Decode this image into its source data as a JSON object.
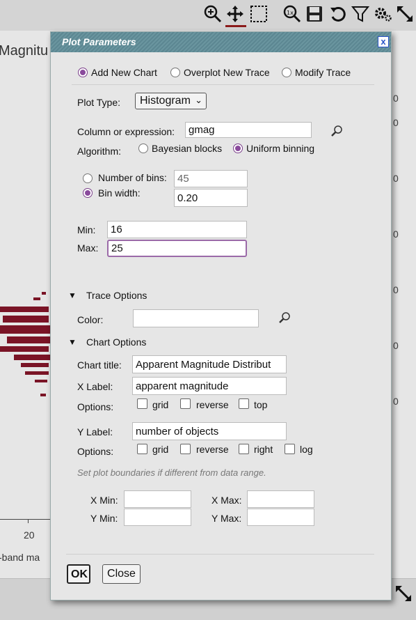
{
  "background": {
    "title": "Magnitu",
    "x_tick_label": "20",
    "x_axis_label": "-band ma",
    "y_axis_right_labels": [
      "0",
      "0",
      "0",
      "0",
      "0",
      "0",
      "0"
    ],
    "data_color": "#7a1426",
    "toolbar_icons": [
      "zoom-in-icon",
      "pan-icon",
      "select-icon",
      "zoom-reset-icon",
      "save-icon",
      "restore-icon",
      "filter-icon",
      "settings-icon",
      "expand-icon"
    ]
  },
  "dialog": {
    "title": "Plot Parameters",
    "close_label": "x",
    "modes": [
      {
        "label": "Add New Chart",
        "selected": true
      },
      {
        "label": "Overplot New Trace",
        "selected": false
      },
      {
        "label": "Modify Trace",
        "selected": false
      }
    ],
    "plot_type": {
      "label": "Plot Type:",
      "value": "Histogram"
    },
    "column": {
      "label": "Column or expression:",
      "value": "gmag"
    },
    "algorithm": {
      "label": "Algorithm:",
      "options": [
        {
          "label": "Bayesian blocks",
          "selected": false
        },
        {
          "label": "Uniform binning",
          "selected": true
        }
      ]
    },
    "bins": {
      "number": {
        "label": "Number of bins:",
        "value": "45",
        "selected": false
      },
      "width": {
        "label": "Bin width:",
        "value": "0.20",
        "selected": true
      }
    },
    "min": {
      "label": "Min:",
      "value": "16"
    },
    "max": {
      "label": "Max:",
      "value": "25"
    },
    "trace_options": {
      "label": "Trace Options",
      "color_label": "Color:",
      "color_value": ""
    },
    "chart_options": {
      "label": "Chart Options",
      "chart_title": {
        "label": "Chart title:",
        "value": "Apparent Magnitude Distribut"
      },
      "x_label": {
        "label": "X Label:",
        "value": "apparent magnitude"
      },
      "x_options": {
        "label": "Options:",
        "items": [
          "grid",
          "reverse",
          "top"
        ]
      },
      "y_label": {
        "label": "Y Label:",
        "value": "number of objects"
      },
      "y_options": {
        "label": "Options:",
        "items": [
          "grid",
          "reverse",
          "right",
          "log"
        ]
      }
    },
    "boundaries_note": "Set plot boundaries if different from data range.",
    "bounds": {
      "x_min": "X Min:",
      "x_max": "X Max:",
      "y_min": "Y Min:",
      "y_max": "Y Max:"
    },
    "ok_label": "OK",
    "close_button_label": "Close"
  }
}
